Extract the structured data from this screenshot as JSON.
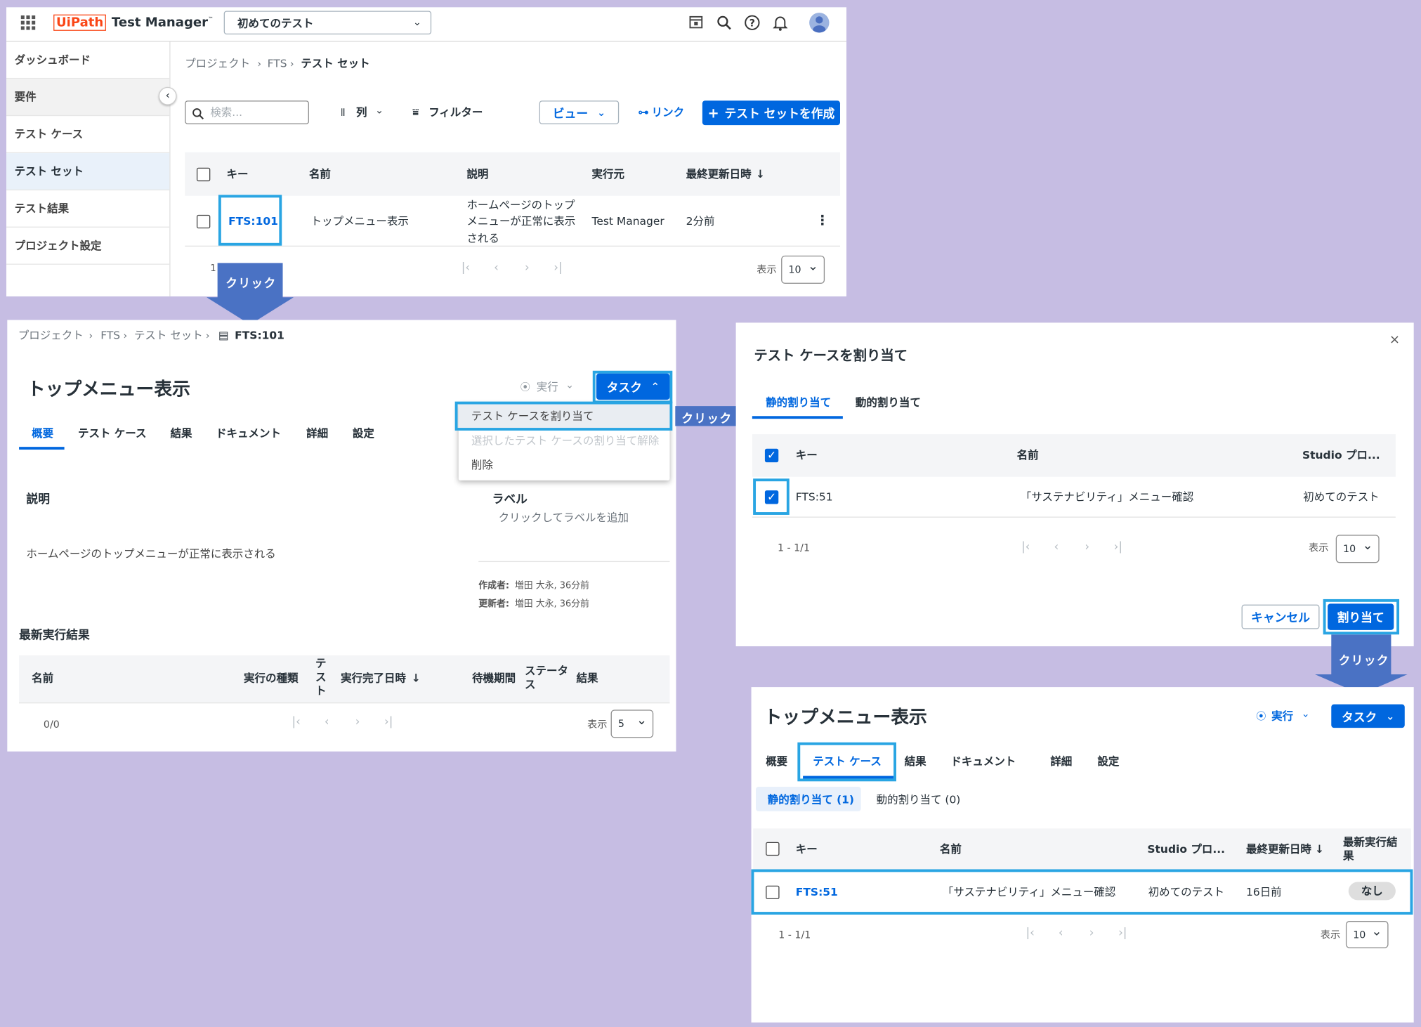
{
  "colors": {
    "accent": "#0067df",
    "highlight": "#29a5e3",
    "callout": "#4a72c4",
    "background": "#c6bde3",
    "brand_red": "#fa4616"
  },
  "p1": {
    "app_grid_icon": "grid-icon",
    "brand": "UiPath",
    "product": "Test Manager",
    "tm": "™",
    "project_selector": "初めてのテスト",
    "top_icons": [
      "calendar-icon",
      "search-icon",
      "help-icon",
      "bell-icon",
      "user-icon"
    ],
    "nav": [
      "ダッシュボード",
      "要件",
      "テスト ケース",
      "テスト セット",
      "テスト結果",
      "プロジェクト設定"
    ],
    "breadcrumb": [
      "プロジェクト",
      "FTS",
      "テスト セット"
    ],
    "search_placeholder": "検索...",
    "columns_label": "列",
    "filter_label": "フィルター",
    "view_label": "ビュー",
    "link_label": "リンク",
    "create_label": "テスト セットを作成",
    "headers": [
      "キー",
      "名前",
      "説明",
      "実行元",
      "最終更新日時"
    ],
    "row": {
      "key": "FTS:101",
      "name": "トップメニュー表示",
      "desc": [
        "ホームページのトップ",
        "メニューが正常に表示",
        "される"
      ],
      "runner": "Test Manager",
      "updated": "2分前"
    },
    "page_num": "1",
    "show_label": "表示",
    "page_size": "10"
  },
  "callouts": {
    "c1": "クリック",
    "c2": "クリック",
    "c3": "クリック"
  },
  "p2": {
    "breadcrumb": [
      "プロジェクト",
      "FTS",
      "テスト セット",
      "FTS:101"
    ],
    "title": "トップメニュー表示",
    "run_label": "実行",
    "task_label": "タスク",
    "menu": [
      "テスト ケースを割り当て",
      "選択したテスト ケースの割り当て解除",
      "削除"
    ],
    "tabs": [
      "概要",
      "テスト ケース",
      "結果",
      "ドキュメント",
      "詳細",
      "設定"
    ],
    "desc_heading": "説明",
    "desc_text": "ホームページのトップメニューが正常に表示される",
    "label_heading": "ラベル",
    "label_hint": "クリックしてラベルを追加",
    "created_label": "作成者:",
    "created_value": "増田 大永, 36分前",
    "updated_label": "更新者:",
    "updated_value": "増田 大永, 36分前",
    "latest_heading": "最新実行結果",
    "table_headers": {
      "name": "名前",
      "kind": "実行の種類",
      "test": "テスト",
      "completed": "実行完了日時",
      "wait": "待機期間",
      "status": "ステータス",
      "result": "結果"
    },
    "count": "0/0",
    "show_label": "表示",
    "page_size": "5"
  },
  "p3": {
    "title": "テスト ケースを割り当て",
    "tabs": [
      "静的割り当て",
      "動的割り当て"
    ],
    "headers": [
      "キー",
      "名前",
      "Studio プロ..."
    ],
    "row": {
      "key": "FTS:51",
      "name": "「サステナビリティ」メニュー確認",
      "project": "初めてのテスト"
    },
    "count": "1 - 1/1",
    "show_label": "表示",
    "page_size": "10",
    "cancel_label": "キャンセル",
    "assign_label": "割り当て"
  },
  "p4": {
    "title": "トップメニュー表示",
    "run_label": "実行",
    "task_label": "タスク",
    "tabs": [
      "概要",
      "テスト ケース",
      "結果",
      "ドキュメント",
      "詳細",
      "設定"
    ],
    "subtabs": [
      "静的割り当て (1)",
      "動的割り当て (0)"
    ],
    "headers": {
      "key": "キー",
      "name": "名前",
      "studio": "Studio プロ...",
      "updated": "最終更新日時",
      "latest": "最新実行結果"
    },
    "row": {
      "key": "FTS:51",
      "name": "「サステナビリティ」メニュー確認",
      "project": "初めてのテスト",
      "updated": "16日前",
      "result": "なし"
    },
    "count": "1 - 1/1",
    "show_label": "表示",
    "page_size": "10"
  }
}
